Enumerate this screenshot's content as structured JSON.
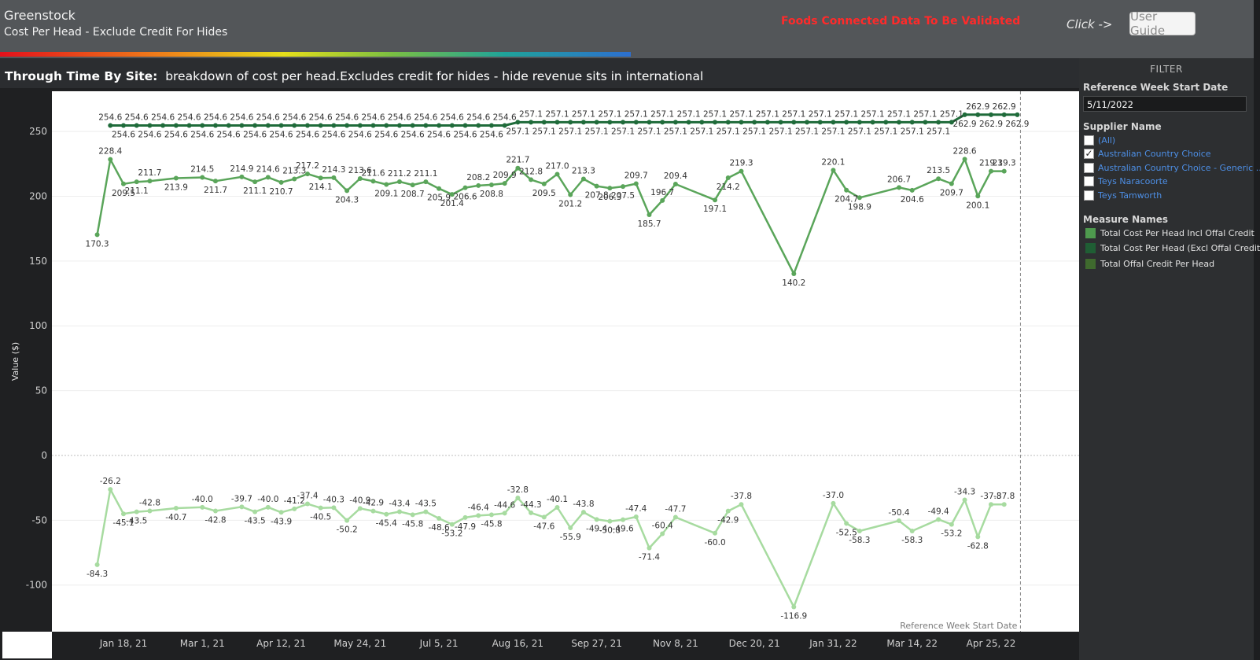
{
  "header": {
    "title": "Greenstock",
    "subtitle": "Cost Per Head - Exclude Credit For Hides",
    "warning": "Foods Connected Data To Be Validated",
    "click_label": "Click ->",
    "guide_button": "User Guide"
  },
  "chart_header": {
    "bold": "Through Time By Site:",
    "text": "breakdown of cost per head.Excludes credit for hides - hide revenue sits in international"
  },
  "filter": {
    "title": "FILTER",
    "date_label": "Reference Week Start Date",
    "date_value": "5/11/2022",
    "supplier_label": "Supplier Name",
    "suppliers": [
      {
        "label": "(All)",
        "checked": false
      },
      {
        "label": "Australian Country Choice",
        "checked": true
      },
      {
        "label": "Australian Country Choice - Generic ...",
        "checked": false
      },
      {
        "label": "Teys Naracoorte",
        "checked": false
      },
      {
        "label": "Teys Tamworth",
        "checked": false
      }
    ],
    "check_mark": "✓",
    "measure_label": "Measure Names",
    "measures": [
      {
        "label": "Total Cost Per Head Incl Offal Credit",
        "color": "#4e9a4e"
      },
      {
        "label": "Total Cost Per Head (Excl Offal Credit)",
        "color": "#1f5e34"
      },
      {
        "label": "Total Offal Credit Per Head",
        "color": "#3f6a2e"
      }
    ]
  },
  "chart_data": {
    "type": "line",
    "title": "",
    "xlabel": "Reference Week Start Date",
    "ylabel": "Value ($)",
    "ylim": [
      -136,
      281
    ],
    "x_date_range": [
      "2021-01-04",
      "2022-05-09"
    ],
    "y_ticks": [
      -100,
      -50,
      0,
      50,
      100,
      150,
      200,
      250
    ],
    "x_ticks": [
      "Jan 18, 21",
      "Mar 1, 21",
      "Apr 12, 21",
      "May 24, 21",
      "Jul 5, 21",
      "Aug 16, 21",
      "Sep 27, 21",
      "Nov 8, 21",
      "Dec 20, 21",
      "Jan 31, 22",
      "Mar 14, 22",
      "Apr 25, 22"
    ],
    "x_tick_dates": [
      "2021-01-18",
      "2021-03-01",
      "2021-04-12",
      "2021-05-24",
      "2021-07-05",
      "2021-08-16",
      "2021-09-27",
      "2021-11-08",
      "2021-12-20",
      "2022-01-31",
      "2022-03-14",
      "2022-04-25"
    ],
    "reference_line_date": "2022-05-09",
    "series": [
      {
        "name": "Total Cost Per Head (Excl Offal Credit)",
        "color": "#1f6b3a",
        "x": [
          "2021-01-11",
          "2021-01-18",
          "2021-01-25",
          "2021-02-01",
          "2021-02-08",
          "2021-02-15",
          "2021-02-22",
          "2021-03-01",
          "2021-03-08",
          "2021-03-15",
          "2021-03-22",
          "2021-03-29",
          "2021-04-05",
          "2021-04-12",
          "2021-04-19",
          "2021-04-26",
          "2021-05-03",
          "2021-05-10",
          "2021-05-17",
          "2021-05-24",
          "2021-05-31",
          "2021-06-07",
          "2021-06-14",
          "2021-06-21",
          "2021-06-28",
          "2021-07-05",
          "2021-07-12",
          "2021-07-19",
          "2021-07-26",
          "2021-08-02",
          "2021-08-09",
          "2021-08-16",
          "2021-08-23",
          "2021-08-30",
          "2021-09-06",
          "2021-09-13",
          "2021-09-20",
          "2021-09-27",
          "2021-10-04",
          "2021-10-11",
          "2021-10-18",
          "2021-10-25",
          "2021-11-01",
          "2021-11-08",
          "2021-11-15",
          "2021-11-22",
          "2021-11-29",
          "2021-12-06",
          "2021-12-13",
          "2021-12-20",
          "2021-12-27",
          "2022-01-03",
          "2022-01-10",
          "2022-01-17",
          "2022-01-24",
          "2022-01-31",
          "2022-02-07",
          "2022-02-14",
          "2022-02-21",
          "2022-02-28",
          "2022-03-07",
          "2022-03-14",
          "2022-03-21",
          "2022-03-28",
          "2022-04-04",
          "2022-04-11",
          "2022-04-18",
          "2022-04-25",
          "2022-05-02",
          "2022-05-09"
        ],
        "values": [
          254.6,
          254.6,
          254.6,
          254.6,
          254.6,
          254.6,
          254.6,
          254.6,
          254.6,
          254.6,
          254.6,
          254.6,
          254.6,
          254.6,
          254.6,
          254.6,
          254.6,
          254.6,
          254.6,
          254.6,
          254.6,
          254.6,
          254.6,
          254.6,
          254.6,
          254.6,
          254.6,
          254.6,
          254.6,
          254.6,
          254.6,
          257.1,
          257.1,
          257.1,
          257.1,
          257.1,
          257.1,
          257.1,
          257.1,
          257.1,
          257.1,
          257.1,
          257.1,
          257.1,
          257.1,
          257.1,
          257.1,
          257.1,
          257.1,
          257.1,
          257.1,
          257.1,
          257.1,
          257.1,
          257.1,
          257.1,
          257.1,
          257.1,
          257.1,
          257.1,
          257.1,
          257.1,
          257.1,
          257.1,
          257.1,
          262.9,
          262.9,
          262.9,
          262.9,
          262.9
        ]
      },
      {
        "name": "Total Cost Per Head Incl Offal Credit",
        "color": "#5aa55a",
        "x": [
          "2021-01-04",
          "2021-01-11",
          "2021-01-18",
          "2021-01-25",
          "2021-02-01",
          "2021-02-15",
          "2021-03-01",
          "2021-03-08",
          "2021-03-22",
          "2021-03-29",
          "2021-04-05",
          "2021-04-12",
          "2021-04-19",
          "2021-04-26",
          "2021-05-03",
          "2021-05-10",
          "2021-05-17",
          "2021-05-24",
          "2021-05-31",
          "2021-06-07",
          "2021-06-14",
          "2021-06-21",
          "2021-06-28",
          "2021-07-05",
          "2021-07-12",
          "2021-07-19",
          "2021-07-26",
          "2021-08-02",
          "2021-08-09",
          "2021-08-16",
          "2021-08-23",
          "2021-08-30",
          "2021-09-06",
          "2021-09-13",
          "2021-09-20",
          "2021-09-27",
          "2021-10-04",
          "2021-10-11",
          "2021-10-18",
          "2021-10-25",
          "2021-11-01",
          "2021-11-08",
          "2021-11-29",
          "2021-12-06",
          "2021-12-13",
          "2022-01-10",
          "2022-01-31",
          "2022-02-07",
          "2022-02-14",
          "2022-03-07",
          "2022-03-14",
          "2022-03-28",
          "2022-04-04",
          "2022-04-11",
          "2022-04-18",
          "2022-04-25",
          "2022-05-02"
        ],
        "values": [
          170.3,
          228.4,
          209.5,
          211.1,
          211.7,
          213.9,
          214.5,
          211.7,
          214.9,
          211.1,
          214.6,
          210.7,
          213.3,
          217.2,
          214.1,
          214.3,
          204.3,
          213.6,
          211.6,
          209.1,
          211.2,
          208.7,
          211.1,
          205.9,
          201.4,
          206.6,
          208.2,
          208.8,
          209.9,
          221.7,
          212.8,
          209.5,
          217.0,
          201.2,
          213.3,
          207.8,
          206.3,
          207.5,
          209.7,
          185.7,
          196.7,
          209.4,
          197.1,
          214.2,
          219.3,
          140.2,
          220.1,
          204.7,
          198.9,
          206.7,
          204.6,
          213.5,
          209.7,
          228.6,
          200.1,
          219.3,
          219.3
        ]
      },
      {
        "name": "Total Offal Credit Per Head",
        "color": "#a7dba0",
        "x": [
          "2021-01-04",
          "2021-01-11",
          "2021-01-18",
          "2021-01-25",
          "2021-02-01",
          "2021-02-15",
          "2021-03-01",
          "2021-03-08",
          "2021-03-22",
          "2021-03-29",
          "2021-04-05",
          "2021-04-12",
          "2021-04-19",
          "2021-04-26",
          "2021-05-03",
          "2021-05-10",
          "2021-05-17",
          "2021-05-24",
          "2021-05-31",
          "2021-06-07",
          "2021-06-14",
          "2021-06-21",
          "2021-06-28",
          "2021-07-05",
          "2021-07-12",
          "2021-07-19",
          "2021-07-26",
          "2021-08-02",
          "2021-08-09",
          "2021-08-16",
          "2021-08-23",
          "2021-08-30",
          "2021-09-06",
          "2021-09-13",
          "2021-09-20",
          "2021-09-27",
          "2021-10-04",
          "2021-10-11",
          "2021-10-18",
          "2021-10-25",
          "2021-11-01",
          "2021-11-08",
          "2021-11-29",
          "2021-12-06",
          "2021-12-13",
          "2022-01-10",
          "2022-01-31",
          "2022-02-07",
          "2022-02-14",
          "2022-03-07",
          "2022-03-14",
          "2022-03-28",
          "2022-04-04",
          "2022-04-11",
          "2022-04-18",
          "2022-04-25",
          "2022-05-02"
        ],
        "values": [
          -84.3,
          -26.2,
          -45.1,
          -43.5,
          -42.8,
          -40.7,
          -40.0,
          -42.8,
          -39.7,
          -43.5,
          -40.0,
          -43.9,
          -41.2,
          -37.4,
          -40.5,
          -40.3,
          -50.2,
          -40.9,
          -42.9,
          -45.4,
          -43.4,
          -45.8,
          -43.5,
          -48.6,
          -53.2,
          -47.9,
          -46.4,
          -45.8,
          -44.6,
          -32.8,
          -44.3,
          -47.6,
          -40.1,
          -55.9,
          -43.8,
          -49.4,
          -50.8,
          -49.6,
          -47.4,
          -71.4,
          -60.4,
          -47.7,
          -60.0,
          -42.9,
          -37.8,
          -116.9,
          -37.0,
          -52.5,
          -58.3,
          -50.4,
          -58.3,
          -49.4,
          -53.2,
          -34.3,
          -62.8,
          -37.8,
          -37.8
        ]
      }
    ],
    "label_overrides": {}
  }
}
